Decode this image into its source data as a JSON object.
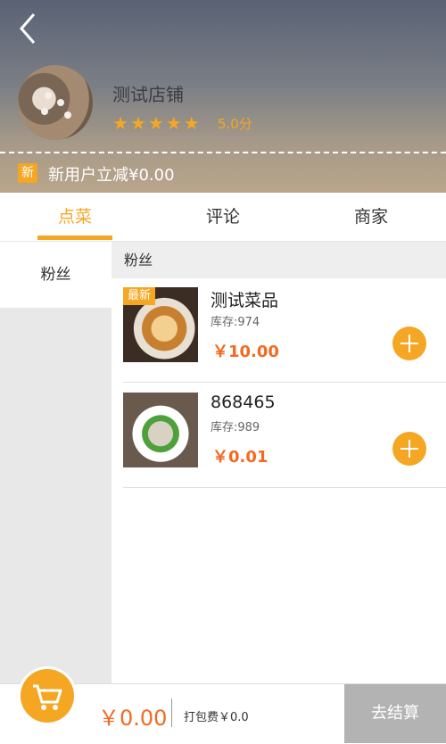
{
  "header": {
    "shop_name": "测试店铺",
    "rating": 5,
    "score_label": "5.0分",
    "promo_badge": "新",
    "promo_text": "新用户立减¥0.00"
  },
  "tabs": [
    {
      "label": "点菜",
      "active": true
    },
    {
      "label": "评论",
      "active": false
    },
    {
      "label": "商家",
      "active": false
    }
  ],
  "sidebar": {
    "items": [
      {
        "label": "粉丝",
        "selected": true
      }
    ]
  },
  "category": {
    "title": "粉丝"
  },
  "items": [
    {
      "badge": "最新",
      "name": "测试菜品",
      "stock": "库存:974",
      "price": "￥10.00"
    },
    {
      "badge": "",
      "name": "868465",
      "stock": "库存:989",
      "price": "￥0.01"
    }
  ],
  "footer": {
    "total": "￥0.00",
    "packing_fee": "打包费￥0.0",
    "checkout_label": "去结算"
  },
  "colors": {
    "accent": "#f5a623",
    "price": "#f26a22"
  }
}
